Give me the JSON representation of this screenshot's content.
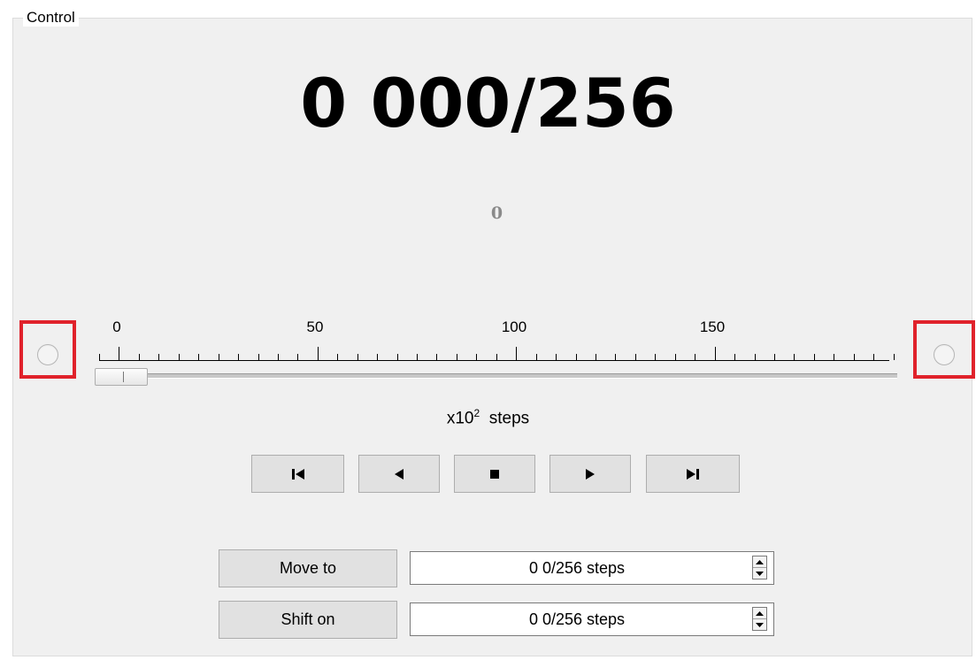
{
  "group": {
    "title": "Control"
  },
  "position_display": {
    "value": "0 000/256"
  },
  "secondary_display": {
    "value": "0"
  },
  "slider": {
    "tick_labels": [
      "0",
      "50",
      "100",
      "150"
    ],
    "units_prefix": "x10",
    "units_exponent": "2",
    "units_suffix": "steps",
    "value": 0
  },
  "limits": {
    "left": {
      "state": "off"
    },
    "right": {
      "state": "off"
    },
    "highlight_color": "#e0222b"
  },
  "transport": {
    "buttons": [
      "skip-to-start",
      "step-back",
      "stop",
      "step-forward",
      "skip-to-end"
    ]
  },
  "move_to": {
    "label": "Move to",
    "value": "0 0/256 steps"
  },
  "shift_on": {
    "label": "Shift on",
    "value": "0 0/256 steps"
  }
}
